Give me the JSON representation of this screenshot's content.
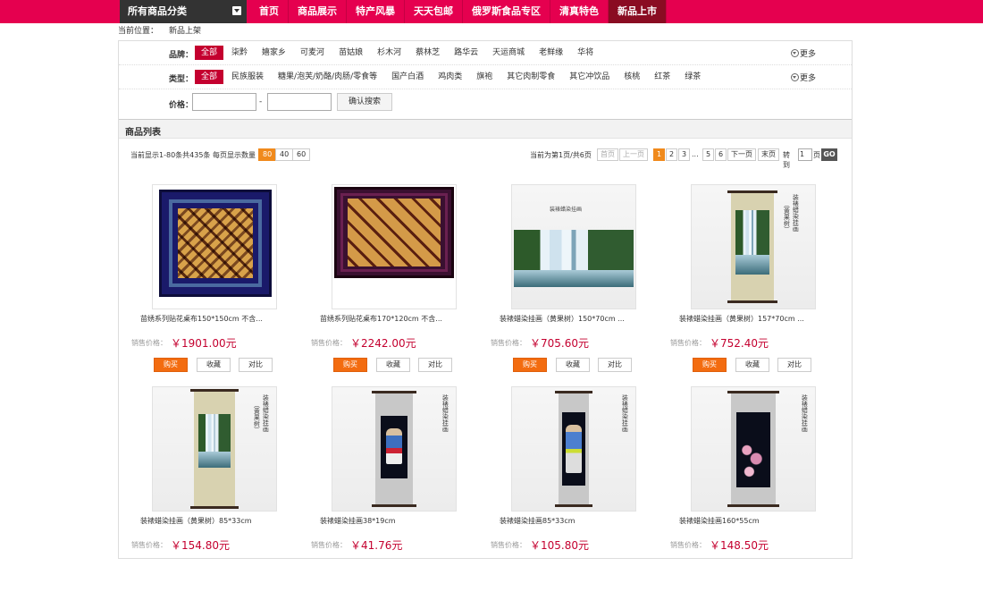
{
  "nav": {
    "category_label": "所有商品分类",
    "links": [
      {
        "label": "首页",
        "active": false
      },
      {
        "label": "商品展示",
        "active": false
      },
      {
        "label": "特产风暴",
        "active": false
      },
      {
        "label": "天天包邮",
        "active": false
      },
      {
        "label": "俄罗斯食品专区",
        "active": false
      },
      {
        "label": "清真特色",
        "active": false
      },
      {
        "label": "新品上市",
        "active": true
      }
    ]
  },
  "breadcrumb": {
    "label": "当前位置：",
    "current": "新品上架"
  },
  "filters": {
    "brand": {
      "label": "品牌：",
      "options": [
        "全部",
        "柒黔",
        "嬉家乡",
        "可麦河",
        "苗姑娘",
        "杉木河",
        "蔡林芝",
        "路华云",
        "天运商城",
        "老鲜缘",
        "华将"
      ],
      "selected": 0
    },
    "type": {
      "label": "类型：",
      "options": [
        "全部",
        "民族服装",
        "糖果/泡芙/奶酪/肉肠/零食等",
        "国产白酒",
        "鸡肉类",
        "旗袍",
        "其它肉制零食",
        "其它冲饮品",
        "核桃",
        "红茶",
        "绿茶"
      ],
      "selected": 0
    },
    "more_label": "更多",
    "price": {
      "label": "价格：",
      "dash": "-",
      "min_value": "",
      "max_value": "",
      "search_button": "确认搜索"
    }
  },
  "list": {
    "title": "商品列表",
    "summary": "当前显示1-80条共435条",
    "per_page_label": "每页显示数量",
    "per_page_options": [
      "80",
      "40",
      "60"
    ],
    "per_page_selected": 0
  },
  "pager": {
    "status": "当前为第1页/共6页",
    "first": "首页",
    "prev": "上一页",
    "pages": [
      "1",
      "2",
      "3"
    ],
    "ellipsis": "...",
    "tail_pages": [
      "5",
      "6"
    ],
    "next": "下一页",
    "last": "末页",
    "goto_label": "转到",
    "goto_value": "1",
    "goto_unit": "页",
    "go_button": "GO"
  },
  "product_labels": {
    "price_label": "销售价格：",
    "buy": "购买",
    "favorite": "收藏",
    "compare": "对比"
  },
  "products": [
    {
      "name": "苗绣系列贴花桌布150*150cm 不含...",
      "price": "￥1901.00元"
    },
    {
      "name": "苗绣系列贴花桌布170*120cm 不含...",
      "price": "￥2242.00元"
    },
    {
      "name": "装裱蜡染挂画（黄果树）150*70cm ...",
      "price": "￥705.60元"
    },
    {
      "name": "装裱蜡染挂画（黄果树）157*70cm ...",
      "price": "￥752.40元"
    },
    {
      "name": "装裱蜡染挂画（黄果树）85*33cm",
      "price": "￥154.80元"
    },
    {
      "name": "装裱蜡染挂画38*19cm",
      "price": "￥41.76元"
    },
    {
      "name": "装裱蜡染挂画85*33cm",
      "price": "￥105.80元"
    },
    {
      "name": "装裱蜡染挂画160*55cm",
      "price": "￥148.50元"
    }
  ],
  "artwork_text": {
    "scroll_caption": "装裱蜡染挂画",
    "scroll_subcaption": "（黄果树）"
  },
  "colors": {
    "nav_bg": "#e5004f",
    "selected": "#c4002f",
    "buy_button": "#f36c10",
    "price": "#c4002f",
    "pager_active": "#f08a1c"
  }
}
